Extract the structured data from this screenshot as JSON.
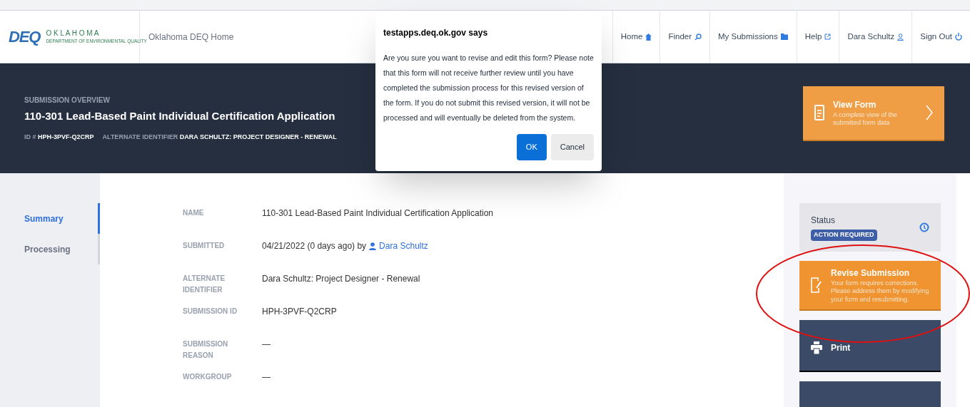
{
  "header": {
    "logo": {
      "mark": "DEQ",
      "state": "O K L A H O M A",
      "agency": "DEPARTMENT OF ENVIRONMENTAL QUALITY"
    },
    "home_link": "Oklahoma DEQ Home",
    "nav": [
      {
        "label": "Home",
        "kind": "home"
      },
      {
        "label": "Finder",
        "kind": "search"
      },
      {
        "label": "My Submissions",
        "kind": "folder"
      },
      {
        "label": "Help",
        "kind": "external"
      },
      {
        "label": "Dara Schultz",
        "kind": "user"
      },
      {
        "label": "Sign Out",
        "kind": "power"
      }
    ]
  },
  "overview": {
    "eyebrow": "SUBMISSION OVERVIEW",
    "title": "110-301 Lead-Based Paint Individual Certification Application",
    "id_label": "ID #",
    "id_value": "HPH-3PVF-Q2CRP",
    "alt_label": "ALTERNATE IDENTIFIER",
    "alt_value": "DARA SCHULTZ: PROJECT DESIGNER - RENEWAL"
  },
  "sidebar": {
    "tabs": [
      {
        "label": "Summary",
        "selected": true
      },
      {
        "label": "Processing",
        "selected": false
      }
    ]
  },
  "fields": [
    {
      "label": "NAME",
      "value": "110-301 Lead-Based Paint Individual Certification Application",
      "kind": "text"
    },
    {
      "label": "SUBMITTED",
      "value": "04/21/2022 (0 days ago) by",
      "link": "Dara Schultz",
      "kind": "user"
    },
    {
      "label": "ALTERNATE IDENTIFIER",
      "value": "Dara Schultz: Project Designer - Renewal",
      "kind": "text"
    },
    {
      "label": "SUBMISSION ID",
      "value": "HPH-3PVF-Q2CRP",
      "kind": "text"
    },
    {
      "label": "SUBMISSION REASON",
      "value": "—",
      "kind": "text"
    },
    {
      "label": "WORKGROUP",
      "value": "—",
      "kind": "text"
    }
  ],
  "actions": {
    "view_form": {
      "title": "View Form",
      "description": "A complete view of the submitted form data"
    },
    "status": {
      "label": "Status",
      "badge": "ACTION REQUIRED"
    },
    "revise": {
      "title": "Revise Submission",
      "description": "Your form requires corrections. Please address them by modifying your form and resubmitting."
    },
    "print": {
      "title": "Print"
    }
  },
  "dialog": {
    "title": "testapps.deq.ok.gov says",
    "message": "Are you sure you want to revise and edit this form? Please note that this form will not receive further review until you have completed the submission process for this revised version of the form. If you do not submit this revised version, it will not be processed and will eventually be deleted from the system.",
    "buttons": [
      {
        "label": "OK",
        "kind": "primary"
      },
      {
        "label": "Cancel",
        "kind": "secondary"
      }
    ]
  }
}
